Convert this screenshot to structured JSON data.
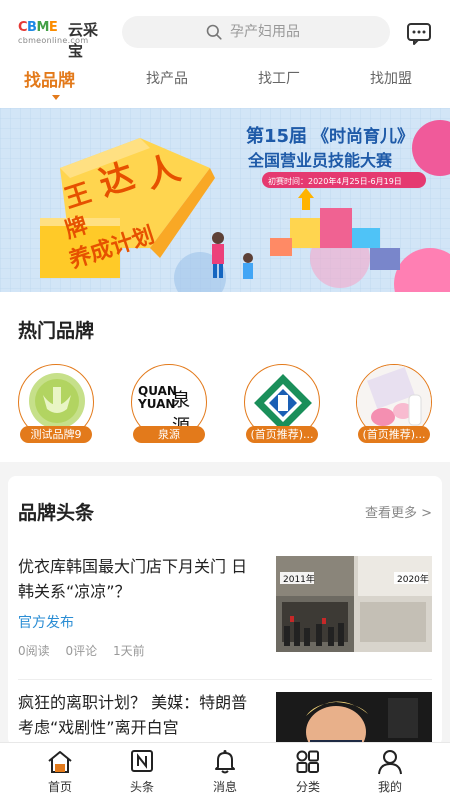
{
  "header": {
    "logo_text": "CBME",
    "logo_cn": "云采宝",
    "logo_url": "cbmeonline.com",
    "search_placeholder": "孕产妇用品"
  },
  "tabs": [
    {
      "label": "找品牌",
      "active": true
    },
    {
      "label": "找产品",
      "active": false
    },
    {
      "label": "找工厂",
      "active": false
    },
    {
      "label": "找加盟",
      "active": false
    }
  ],
  "banner": {
    "headline_num": "第15届",
    "headline_title": "《时尚育儿》",
    "subtitle": "全国营业员技能大赛",
    "date_text": "初赛时间：2020年4月25日-6月19日",
    "art_text": "王牌达人养成计划"
  },
  "hot_brands": {
    "title": "热门品牌",
    "items": [
      {
        "label": "测试品牌9"
      },
      {
        "label": "泉源",
        "logo_line1": "QUAN",
        "logo_line2": "YUAN",
        "logo_cn": "泉源"
      },
      {
        "label": "(首页推荐)..."
      },
      {
        "label": "(首页推荐)..."
      }
    ]
  },
  "news": {
    "title": "品牌头条",
    "more": "查看更多 >",
    "items": [
      {
        "title": "优衣库韩国最大门店下月关门 日韩关系“凉凉”？",
        "source": "官方发布",
        "reads": "0阅读",
        "comments": "0评论",
        "time": "1天前",
        "thumb_left": "2011年",
        "thumb_right": "2020年"
      },
      {
        "title": "疯狂的离职计划？ 美媒：特朗普考虑“戏剧性”离开白宫"
      }
    ]
  },
  "bottom_nav": [
    {
      "label": "首页",
      "icon": "home-icon",
      "active": true
    },
    {
      "label": "头条",
      "icon": "news-icon",
      "active": false
    },
    {
      "label": "消息",
      "icon": "bell-icon",
      "active": false
    },
    {
      "label": "分类",
      "icon": "category-icon",
      "active": false
    },
    {
      "label": "我的",
      "icon": "user-icon",
      "active": false
    }
  ],
  "colors": {
    "accent": "#e37a1b",
    "link": "#2a8dd4"
  }
}
